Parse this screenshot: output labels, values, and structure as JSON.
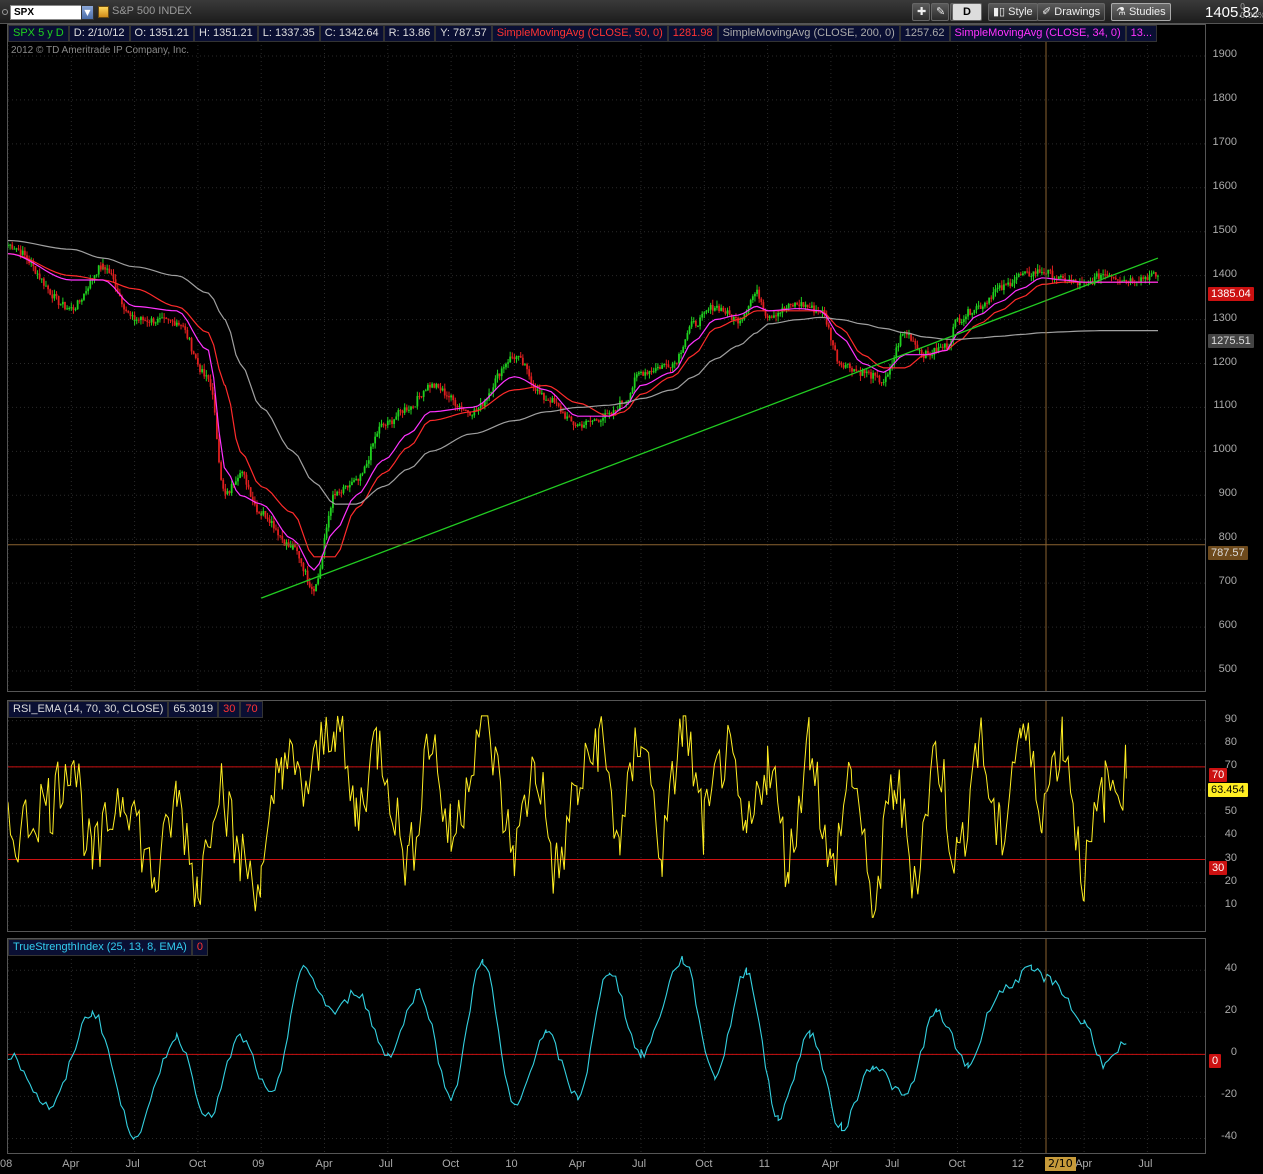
{
  "toolbar": {
    "symbol": "SPX",
    "index_name": "S&P 500 INDEX",
    "period_button": "D",
    "style_label": "Style",
    "drawings_label": "Drawings",
    "studies_label": "Studies",
    "last_price": "1405.82",
    "change_top": "0",
    "change_bottom": "0.00%"
  },
  "price_legend": {
    "symbol_period": "SPX 5 y D",
    "date": "D: 2/10/12",
    "open": "O: 1351.21",
    "high": "H: 1351.21",
    "low": "L: 1337.35",
    "close": "C: 1342.64",
    "range": "R: 13.86",
    "y": "Y: 787.57",
    "sma50_label": "SimpleMovingAvg (CLOSE, 50, 0)",
    "sma50_value": "1281.98",
    "sma200_label": "SimpleMovingAvg (CLOSE, 200, 0)",
    "sma200_value": "1257.62",
    "sma34_label": "SimpleMovingAvg (CLOSE, 34, 0)",
    "sma34_value": "13...",
    "copyright": "2012 © TD Ameritrade IP Company, Inc."
  },
  "rsi_legend": {
    "label": "RSI_EMA (14, 70, 30, CLOSE)",
    "value": "65.3019",
    "low": "30",
    "high": "70"
  },
  "tsi_legend": {
    "label": "TrueStrengthIndex (25, 13, 8, EMA)",
    "value": "0"
  },
  "tags": {
    "price_close": "1385.04",
    "sma200_tag": "1275.51",
    "cursor_y": "787.57",
    "rsi_70": "70",
    "rsi_value": "63.454",
    "rsi_30": "30",
    "tsi_zero": "0",
    "cursor_date": "2/10"
  },
  "colors": {
    "price_up": "#1fd21f",
    "price_down": "#e01f1f",
    "sma50": "#ff2b2b",
    "sma200": "#a0a0a0",
    "sma34": "#ff33ff",
    "trendline": "#22cc22",
    "rsi": "#ffee22",
    "tsi": "#33d0e0",
    "ref_line": "#cc1111",
    "cursor": "#8a6230"
  },
  "chart_data": [
    {
      "type": "line",
      "title": "SPX 5 y D",
      "x_ticks": [
        "08",
        "Apr",
        "Jul",
        "Oct",
        "09",
        "Apr",
        "Jul",
        "Oct",
        "10",
        "Apr",
        "Jul",
        "Oct",
        "11",
        "Apr",
        "Jul",
        "Oct",
        "12",
        "Apr",
        "Jul"
      ],
      "ylim": [
        450,
        1950
      ],
      "y_ticks": [
        500,
        600,
        700,
        800,
        900,
        1000,
        1100,
        1200,
        1300,
        1400,
        1500,
        1600,
        1700,
        1800,
        1900
      ],
      "x_months": [
        0,
        3,
        4.5,
        6,
        8,
        9.5,
        10.3,
        11,
        12,
        13.5,
        14.5,
        15.5,
        16.5,
        17.8,
        19,
        20,
        22,
        24,
        25.5,
        27,
        28.5,
        29.2,
        30,
        31.5,
        32.5,
        33.5,
        34.6,
        35.5,
        36,
        37.5,
        38.5,
        39.5,
        40.5,
        41.5,
        42.5,
        43.5,
        44.5,
        45,
        46,
        47,
        48,
        49,
        50,
        51,
        52,
        53,
        54.5
      ],
      "series": [
        {
          "name": "SPX",
          "values": [
            1470,
            1325,
            1420,
            1300,
            1295,
            1165,
            900,
            950,
            860,
            780,
            690,
            900,
            930,
            1060,
            1100,
            1150,
            1090,
            1215,
            1120,
            1060,
            1080,
            1115,
            1180,
            1200,
            1290,
            1330,
            1300,
            1360,
            1310,
            1335,
            1320,
            1200,
            1180,
            1160,
            1270,
            1220,
            1240,
            1300,
            1330,
            1370,
            1400,
            1410,
            1390,
            1380,
            1405,
            1390,
            1400
          ]
        },
        {
          "name": "SimpleMovingAvg (CLOSE, 50, 0)",
          "values": [
            1450,
            1400,
            1390,
            1370,
            1330,
            1270,
            1150,
            1000,
            920,
            860,
            760,
            760,
            870,
            950,
            1010,
            1070,
            1090,
            1140,
            1150,
            1110,
            1080,
            1090,
            1130,
            1170,
            1220,
            1280,
            1300,
            1320,
            1320,
            1320,
            1320,
            1280,
            1220,
            1190,
            1190,
            1220,
            1230,
            1250,
            1290,
            1320,
            1350,
            1380,
            1385,
            1385,
            1385,
            1385,
            1385
          ]
        },
        {
          "name": "SimpleMovingAvg (CLOSE, 200, 0)",
          "values": [
            1480,
            1460,
            1440,
            1420,
            1400,
            1360,
            1300,
            1200,
            1100,
            1000,
            930,
            880,
            880,
            920,
            960,
            1000,
            1040,
            1070,
            1090,
            1100,
            1105,
            1110,
            1120,
            1140,
            1170,
            1210,
            1240,
            1270,
            1290,
            1300,
            1305,
            1300,
            1290,
            1280,
            1270,
            1260,
            1255,
            1255,
            1258,
            1262,
            1266,
            1270,
            1272,
            1274,
            1275,
            1275,
            1275
          ]
        },
        {
          "name": "SimpleMovingAvg (CLOSE, 34, 0)",
          "values": [
            1450,
            1390,
            1390,
            1330,
            1320,
            1230,
            960,
            900,
            880,
            800,
            730,
            820,
            900,
            980,
            1040,
            1090,
            1100,
            1170,
            1140,
            1080,
            1080,
            1100,
            1150,
            1180,
            1250,
            1300,
            1310,
            1330,
            1320,
            1325,
            1320,
            1260,
            1200,
            1180,
            1220,
            1220,
            1230,
            1270,
            1310,
            1340,
            1370,
            1395,
            1390,
            1385,
            1385,
            1385,
            1385
          ]
        }
      ],
      "trendline": {
        "start": [
          12,
          666
        ],
        "end": [
          54.5,
          1440
        ]
      },
      "cursor_value": 787.57
    },
    {
      "type": "line",
      "title": "RSI_EMA (14, 70, 30, CLOSE)",
      "ylim": [
        0,
        100
      ],
      "y_ticks": [
        10,
        20,
        30,
        40,
        50,
        60,
        70,
        80,
        90
      ],
      "reference_lines": [
        30,
        70
      ],
      "x_months": [
        0,
        2,
        3,
        4,
        5.5,
        7,
        8,
        9,
        10,
        11,
        12,
        13,
        14,
        15.5,
        16.5,
        17.5,
        19,
        20,
        21,
        22.5,
        24,
        25,
        26,
        27,
        28,
        29,
        30,
        31,
        32,
        33,
        34,
        35,
        36,
        37,
        38,
        39,
        40,
        41,
        42,
        43,
        44,
        45,
        46,
        47,
        48,
        49,
        50,
        51,
        52,
        53
      ],
      "series": [
        {
          "name": "RSI_EMA",
          "values": [
            40,
            55,
            75,
            30,
            60,
            22,
            55,
            20,
            65,
            30,
            20,
            75,
            60,
            90,
            50,
            80,
            30,
            82,
            40,
            90,
            35,
            70,
            25,
            60,
            82,
            40,
            85,
            35,
            88,
            45,
            75,
            40,
            72,
            30,
            82,
            25,
            68,
            8,
            62,
            25,
            75,
            30,
            80,
            40,
            86,
            55,
            82,
            25,
            60,
            65
          ]
        }
      ]
    },
    {
      "type": "line",
      "title": "TrueStrengthIndex (25, 13, 8, EMA)",
      "ylim": [
        -45,
        52
      ],
      "y_ticks": [
        -40,
        -20,
        0,
        20,
        40
      ],
      "reference_lines": [
        0
      ],
      "x_months": [
        0,
        2,
        4,
        6,
        8,
        9.5,
        11,
        12.5,
        14,
        15.5,
        16.5,
        18,
        19.5,
        21,
        22.5,
        24,
        25.5,
        27,
        28.5,
        30,
        32,
        33.5,
        35,
        36.5,
        38,
        39.5,
        41,
        42.5,
        44,
        45.5,
        47,
        48.5,
        49.5,
        51,
        52,
        53
      ],
      "series": [
        {
          "name": "TSI",
          "values": [
            0,
            -25,
            20,
            -38,
            8,
            -30,
            8,
            -20,
            40,
            20,
            30,
            0,
            30,
            -20,
            45,
            -25,
            10,
            -20,
            40,
            0,
            45,
            -10,
            40,
            -30,
            10,
            -35,
            -5,
            -20,
            20,
            -5,
            30,
            40,
            35,
            15,
            -5,
            5
          ]
        }
      ]
    }
  ]
}
